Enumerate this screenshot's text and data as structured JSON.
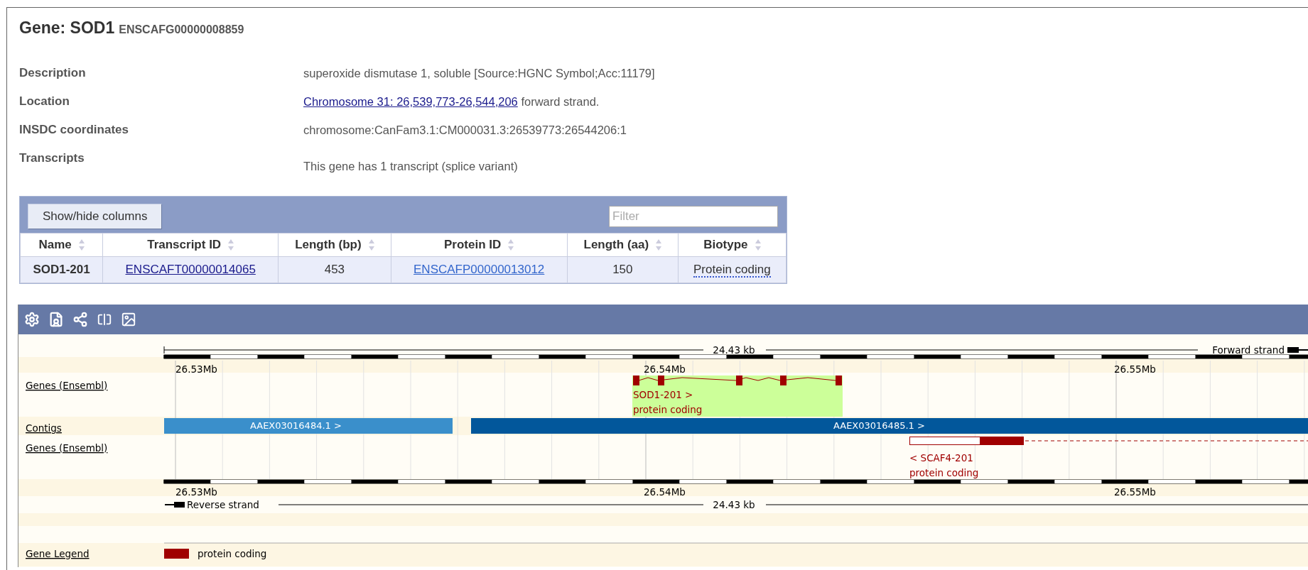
{
  "gene": {
    "title": "Gene: SOD1",
    "id": "ENSCAFG00000008859"
  },
  "summary": [
    {
      "label": "Description",
      "kind": "text",
      "value": "superoxide dismutase 1, soluble [Source:HGNC Symbol;Acc:11179]"
    },
    {
      "label": "Location",
      "kind": "link",
      "link": "Chromosome 31: 26,539,773-26,544,206",
      "value": "forward strand."
    },
    {
      "label": "INSDC coordinates",
      "kind": "text",
      "value": "chromosome:CanFam3.1:CM000031.3:26539773:26544206:1"
    },
    {
      "label": "Transcripts",
      "kind": "note",
      "value": "This gene has 1 transcript (splice variant)"
    }
  ],
  "transcript_table": {
    "button": "Show/hide columns",
    "filter": {
      "placeholder": "Filter"
    },
    "columns": [
      "Name",
      "Transcript ID",
      "Length (bp)",
      "Protein ID",
      "Length (aa)",
      "Biotype"
    ],
    "rows": [
      {
        "cells": [
          {
            "text": "SOD1-201",
            "kind": "bold"
          },
          {
            "text": "ENSCAFT00000014065",
            "kind": "visited-link"
          },
          {
            "text": "453",
            "kind": "text"
          },
          {
            "text": "ENSCAFP00000013012",
            "kind": "link"
          },
          {
            "text": "150",
            "kind": "text"
          },
          {
            "text": "Protein coding",
            "kind": "term"
          }
        ]
      }
    ]
  },
  "browser": {
    "top_scale": {
      "length": "24.43 kb",
      "strand": "Forward strand",
      "ticks": [
        "26.53Mb",
        "26.54Mb",
        "26.55Mb"
      ]
    },
    "bottom_scale": {
      "length": "24.43 kb",
      "strand": "Reverse strand",
      "ticks": [
        "26.53Mb",
        "26.54Mb",
        "26.55Mb"
      ]
    },
    "tracks": [
      "Genes (Ensembl)",
      "Contigs",
      "Genes (Ensembl)"
    ],
    "forward_genes": [
      {
        "name": "SOD1-201 >",
        "biotype": "protein coding",
        "selected": true
      }
    ],
    "contigs": [
      {
        "label": "AAEX03016484.1 >",
        "color": "#3a8fcb"
      },
      {
        "label": "AAEX03016485.1 >",
        "color": "#02579b"
      }
    ],
    "reverse_genes": [
      {
        "name": "< SCAF4-201",
        "biotype": "protein coding",
        "selected": false
      }
    ],
    "legend": {
      "title": "Gene Legend",
      "items": [
        {
          "label": "protein coding",
          "color": "#a00000"
        }
      ]
    }
  }
}
